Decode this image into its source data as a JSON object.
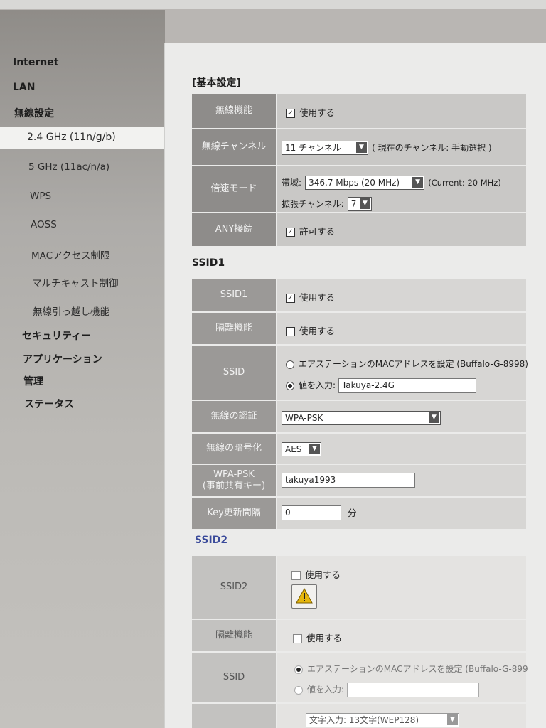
{
  "sidebar": {
    "internet": "Internet",
    "lan": "LAN",
    "wireless": "無線設定",
    "sub_items": [
      "2.4 GHz (11n/g/b)",
      "5 GHz (11ac/n/a)",
      "WPS",
      "AOSS",
      "MACアクセス制限",
      "マルチキャスト制御",
      "無線引っ越し機能"
    ],
    "security": "セキュリティー",
    "application": "アプリケーション",
    "admin": "管理",
    "status": "ステータス"
  },
  "basic": {
    "title": "[基本設定]",
    "wireless_func": {
      "label": "無線機能",
      "option": "使用する",
      "checked": true
    },
    "channel": {
      "label": "無線チャンネル",
      "value": "11 チャンネル",
      "note": "( 現在のチャンネル: 手動選択 )"
    },
    "speed": {
      "label": "倍速モード",
      "band_label": "帯域:",
      "band_value": "346.7 Mbps (20 MHz)",
      "band_note": "(Current: 20 MHz)",
      "ext_label": "拡張チャンネル:",
      "ext_value": "7"
    },
    "any": {
      "label": "ANY接続",
      "option": "許可する",
      "checked": true
    }
  },
  "ssid1": {
    "title": "SSID1",
    "enable": {
      "label": "SSID1",
      "option": "使用する",
      "checked": true
    },
    "isolation": {
      "label": "隔離機能",
      "option": "使用する",
      "checked": false
    },
    "ssid": {
      "label": "SSID",
      "opt_mac": "エアステーションのMACアドレスを設定 (Buffalo-G-8998)",
      "opt_input": "値を入力:",
      "value": "Takuya-2.4G"
    },
    "auth": {
      "label": "無線の認証",
      "value": "WPA-PSK"
    },
    "enc": {
      "label": "無線の暗号化",
      "value": "AES"
    },
    "psk": {
      "label_line1": "WPA-PSK",
      "label_line2": "(事前共有キー)",
      "value": "takuya1993"
    },
    "key_interval": {
      "label": "Key更新間隔",
      "value": "0",
      "unit": "分"
    }
  },
  "ssid2": {
    "title": "SSID2",
    "enable": {
      "label": "SSID2",
      "option": "使用する",
      "checked": false
    },
    "isolation": {
      "label": "隔離機能",
      "option": "使用する",
      "checked": false
    },
    "ssid": {
      "label": "SSID",
      "opt_mac": "エアステーションのMACアドレスを設定 (Buffalo-G-899",
      "opt_input": "値を入力:"
    },
    "bottom_select": "文字入力: 13文字(WEP128)"
  },
  "colors": {
    "label_bg": "#8e8c8a",
    "value_bg": "#c9c8c6",
    "section_blue": "#3a4a9a"
  }
}
